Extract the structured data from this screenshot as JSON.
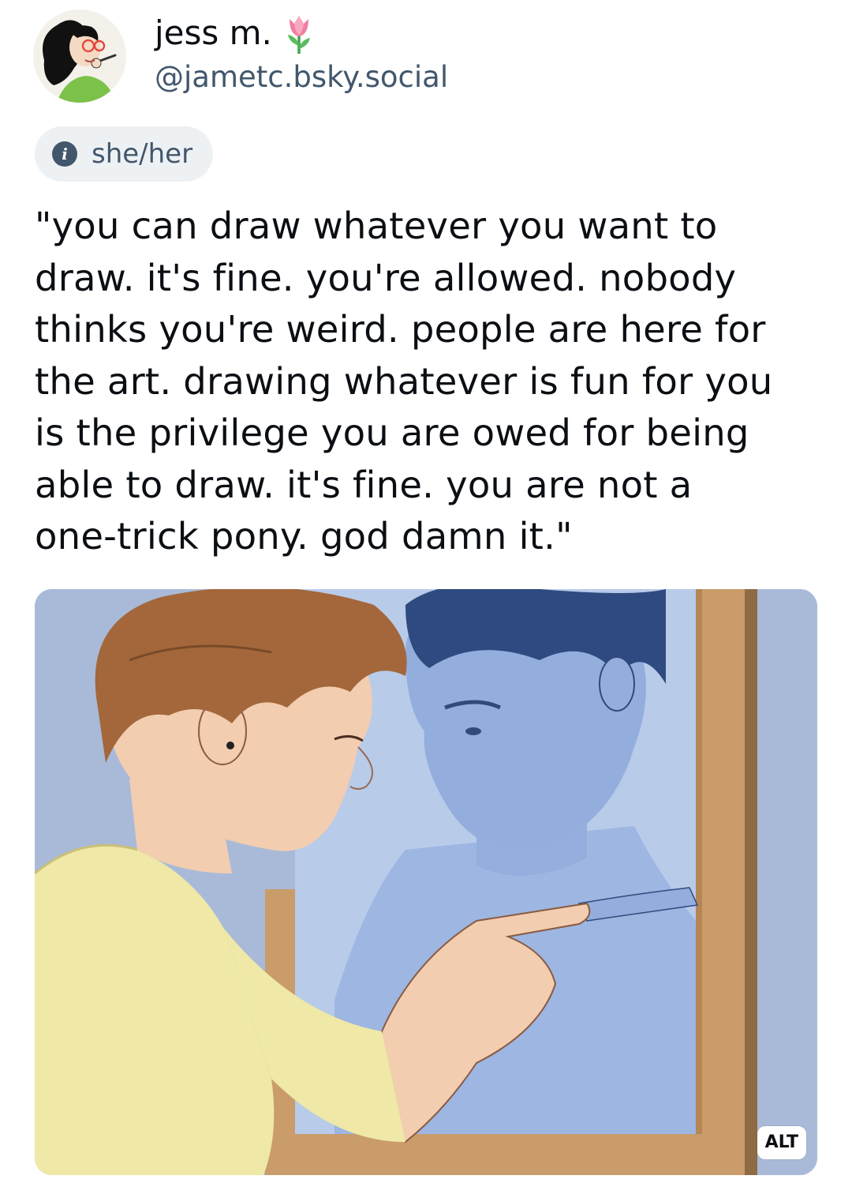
{
  "author": {
    "display_name": "jess m.",
    "emoji_icon": "tulip-icon",
    "handle": "@jametc.bsky.social",
    "pronouns": "she/her"
  },
  "post": {
    "text": "\"you can draw whatever you want to\ndraw. it's fine. you're allowed. nobody\nthinks you're weird. people are here for\nthe art. drawing whatever is fun for you\nis the privilege you are owed for being\nable to draw. it's fine. you are not a\none-trick pony. god damn it.\"",
    "image": {
      "alt_label": "ALT"
    }
  },
  "colors": {
    "text_primary": "#0b0f14",
    "text_secondary": "#42576c",
    "pill_background": "#eef1f4",
    "wall_blue": "#aebfdc",
    "mirror_frame": "#c99c6a",
    "shirt_yellow": "#efe8a6",
    "hair_brown": "#a3673b",
    "skin": "#f2cdb0",
    "reflection_blue": "#93aedd"
  }
}
